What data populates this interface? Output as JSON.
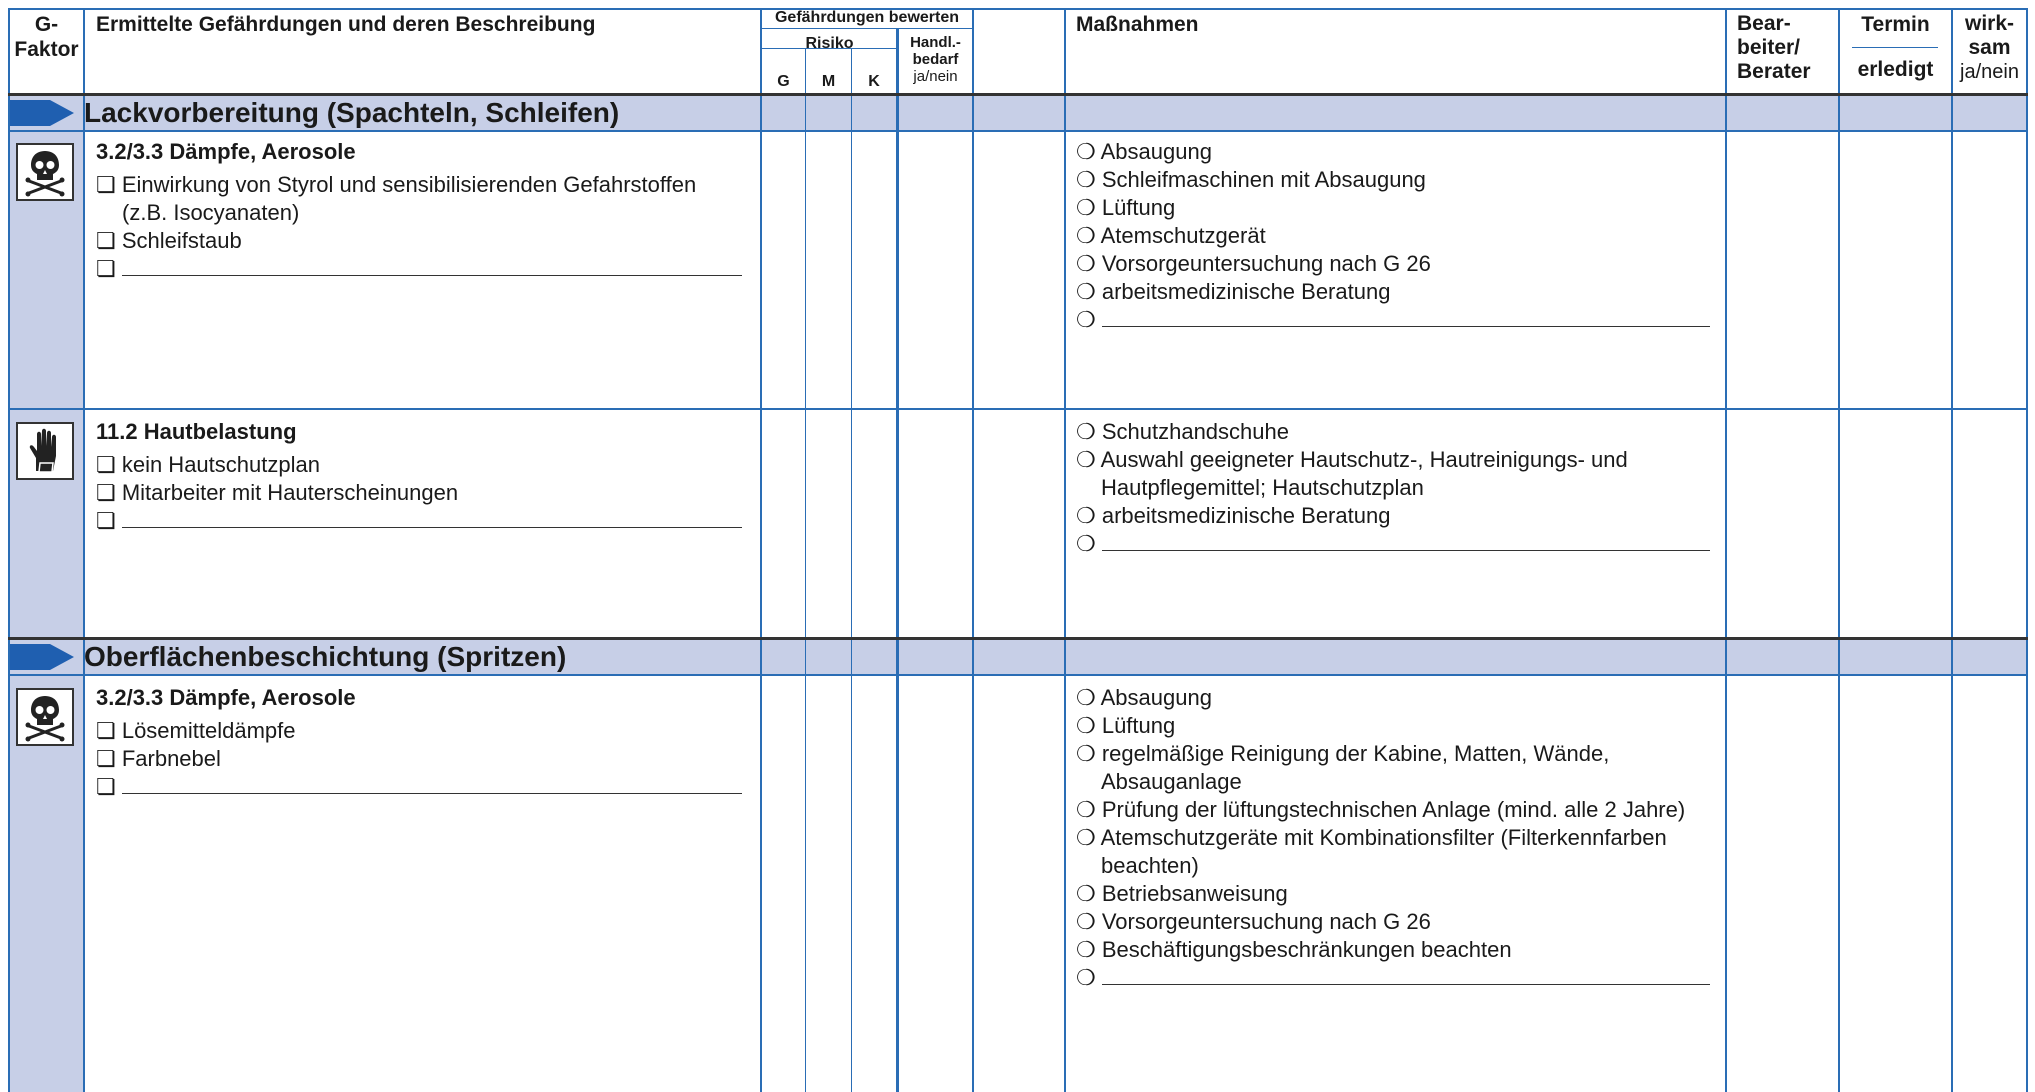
{
  "header": {
    "g_faktor": [
      "G-",
      "Faktor"
    ],
    "gefaehrdungen": "Ermittelte Gefährdungen und deren Beschreibung",
    "bewerten": "Gefährdungen bewerten",
    "risiko": "Risiko",
    "risk_cols": [
      "G",
      "M",
      "K"
    ],
    "handl": [
      "Handl.-",
      "bedarf",
      "ja/nein"
    ],
    "massnahmen": "Maßnahmen",
    "bearbeiter": [
      "Bear-",
      "beiter/",
      "Berater"
    ],
    "termin": "Termin",
    "erledigt": "erledigt",
    "wirksam": [
      "wirk-",
      "sam",
      "ja/nein"
    ]
  },
  "sections": [
    {
      "title": "Lackvorbereitung (Spachteln, Schleifen)",
      "rows": [
        {
          "icon": "skull-crossbones-icon",
          "title": "3.2/3.3  Dämpfe, Aerosole",
          "items": [
            "❏ Einwirkung von Styrol und sensibilisierenden Gefahrstoffen",
            "(z.B. Isocyanaten)",
            "❏ Schleifstaub",
            "❏"
          ],
          "measures": [
            "❍ Absaugung",
            "❍ Schleifmaschinen mit Absaugung",
            "❍ Lüftung",
            "❍ Atemschutzgerät",
            "❍ Vorsorgeuntersuchung nach G 26",
            "❍ arbeitsmedizinische Beratung",
            "❍"
          ]
        },
        {
          "icon": "glove-icon",
          "title": "11.2  Hautbelastung",
          "items": [
            "❏ kein Hautschutzplan",
            "❏ Mitarbeiter mit Hauterscheinungen",
            "❏"
          ],
          "measures": [
            "❍ Schutzhandschuhe",
            "❍ Auswahl geeigneter Hautschutz-, Hautreinigungs- und",
            "Hautpflegemittel; Hautschutzplan",
            "❍ arbeitsmedizinische Beratung",
            "❍"
          ]
        }
      ]
    },
    {
      "title": "Oberflächenbeschichtung (Spritzen)",
      "rows": [
        {
          "icon": "skull-crossbones-icon",
          "title": "3.2/3.3  Dämpfe, Aerosole",
          "items": [
            "❏ Lösemitteldämpfe",
            "❏ Farbnebel",
            "❏"
          ],
          "measures": [
            "❍ Absaugung",
            "❍ Lüftung",
            "❍ regelmäßige Reinigung der Kabine, Matten, Wände,",
            "Absauganlage",
            "❍ Prüfung der lüftungstechnischen Anlage (mind. alle 2 Jahre)",
            "❍ Atemschutzgeräte mit Kombinationsfilter (Filterkennfarben",
            "beachten)",
            "❍ Betriebsanweisung",
            "❍ Vorsorgeuntersuchung nach G 26",
            "❍ Beschäftigungsbeschränkungen beachten",
            "❍"
          ]
        }
      ]
    }
  ],
  "colors": {
    "accent": "#2a6db5",
    "band": "#c7cfe7",
    "arrow": "#1f5fb0"
  }
}
